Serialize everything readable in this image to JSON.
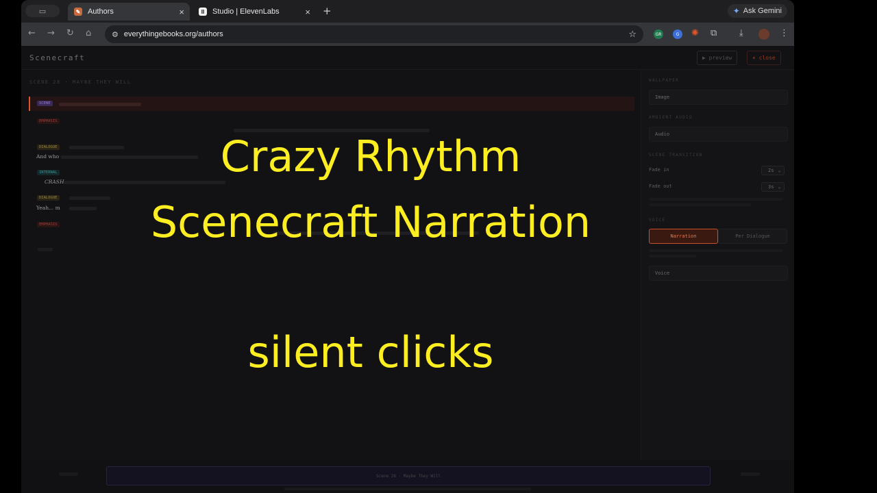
{
  "browser": {
    "tabs": [
      {
        "title": "Authors",
        "active": true
      },
      {
        "title": "Studio | ElevenLabs",
        "active": false
      }
    ],
    "new_tab_label": "+",
    "close_label": "×",
    "ask_gemini": "Ask Gemini",
    "url": "everythingebooks.org/authors",
    "ext_labels": [
      "GR",
      "G"
    ]
  },
  "app": {
    "brand": "Scenecraft",
    "preview_label": "▶ preview",
    "close_label": "× close",
    "scene_heading": "SCENE 28 · MAYBE THEY WILL",
    "blocks": [
      {
        "tag": "SCENE"
      },
      {
        "tag": "EMPHASIS"
      },
      {
        "tag": "DIALOGUE",
        "text": "And who"
      },
      {
        "tag": "INTERNAL",
        "text": "CRASH"
      },
      {
        "tag": "DIALOGUE",
        "text": "Yeah... m"
      },
      {
        "tag": "EMPHASIS"
      }
    ],
    "sidebar": {
      "wallpaper_heading": "WALLPAPER",
      "image_label": "Image",
      "ambient_heading": "AMBIENT AUDIO",
      "audio_label": "Audio",
      "transition_heading": "SCENE TRANSITION",
      "fade_in_label": "Fade in",
      "fade_in_value": "2s",
      "fade_out_label": "Fade out",
      "fade_out_value": "3s",
      "voice_heading": "VOICE",
      "narration_label": "Narration",
      "per_dialogue_label": "Per Dialogue",
      "voice_label": "Voice"
    },
    "footer": {
      "scene_title": "Scene 28 · Maybe They Will"
    }
  },
  "overlay": {
    "line1": "Crazy Rhythm",
    "line2": "Scenecraft Narration",
    "line3": "silent clicks"
  },
  "colors": {
    "accent": "#e0562b",
    "overlay_text": "#fcee21"
  }
}
